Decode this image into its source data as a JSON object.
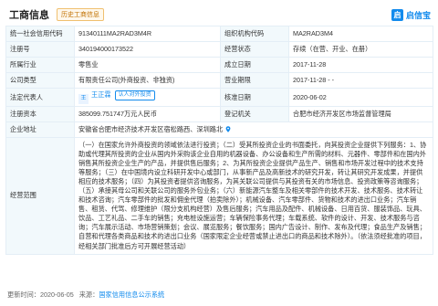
{
  "header": {
    "title": "工商信息",
    "history_button": "历史工商信息",
    "logo_mark": "启",
    "logo_text": "启信宝",
    "logo_color": "#128bed"
  },
  "fields": {
    "credit_code": {
      "label": "统一社会信用代码",
      "value": "91340111MA2RAD3M4R"
    },
    "org_code": {
      "label": "组织机构代码",
      "value": "MA2RAD3M4"
    },
    "reg_no": {
      "label": "注册号",
      "value": "340194000173522"
    },
    "status": {
      "label": "经营状态",
      "value": "存续（在营、开业、在册）"
    },
    "industry": {
      "label": "所属行业",
      "value": "零售业"
    },
    "established": {
      "label": "成立日期",
      "value": "2017-11-28"
    },
    "company_type": {
      "label": "公司类型",
      "value": "有限责任公司(外商投资、非独资)"
    },
    "business_term": {
      "label": "营业期限",
      "value": "2017-11-28 - -"
    },
    "legal_rep": {
      "label": "法定代表人",
      "avatar": "王",
      "name": "王正霖",
      "tag": "认人对外投资"
    },
    "approved": {
      "label": "核准日期",
      "value": "2020-06-02"
    },
    "capital": {
      "label": "注册资本",
      "value": "385099.751747万元人民币"
    },
    "authority": {
      "label": "登记机关",
      "value": "合肥市经济开发区市场监督管理局"
    },
    "address": {
      "label": "企业地址",
      "value": "安徽省合肥市经济技术开发区宿松路西、深圳路北"
    },
    "scope": {
      "label": "经营范围",
      "value": "（一）在国家允许外商投资的领域依法进行投资；（二）受其所投资企业的书面委托，向其投资企业提供下列服务：1、协助或代理其所投资的企业从国内外采购该企业自用的机器设备、办公设备和生产所需的材料、元器件、零部件和在国内外销售其所投资企业生产的产品，并提供售后服务；2、为其所投资企业提供产品生产、销售和市场开发过程中的技术支持等服务；（三）在中国境内设立科研开发中心或部门，从事新产品及高新技术的研究开发，转让其研究开发成果，并提供相应的技术服务；（四）为其投资者提供咨询服务，为其关联公司提供与其投资有关的市场信息、投资政策等咨询服务；（五）承接其母公司和关联公司的服务外包业务；（六）新能源汽车整车及相关零部件的技术开发、技术服务、技术转让和技术咨询；汽车零部件的批发和佣金代理（拍卖除外）；机械设备、汽车零部件、货物和技术的进出口业务；汽车销售、租赁、代驾、修理维护（限分支机构经营）及售后服务；汽车用品及配件、机械设备、日用百货、服装饰品、玩具、饮品、工艺礼品、二手车的销售；充电桩设施运营；车辆保险事务代理；车载系统、软件的设计、开发、技术服务与咨询；汽车展示活动、市场营销策划；会议、展览服务；餐饮服务；国内广告设计、制作、发布及代理；食品生产及销售；自营和代理各类商品和技术的进出口业务（国家限定企业经营或禁止进出口的商品和技术除外）。（依法须经批准的项目，经相关部门批准后方可开展经营活动）"
    }
  },
  "footer": {
    "update_prefix": "更新时间：",
    "update_time": "2020-06-05",
    "source_prefix": "来源：",
    "source": "国家信用信息公示系统"
  }
}
